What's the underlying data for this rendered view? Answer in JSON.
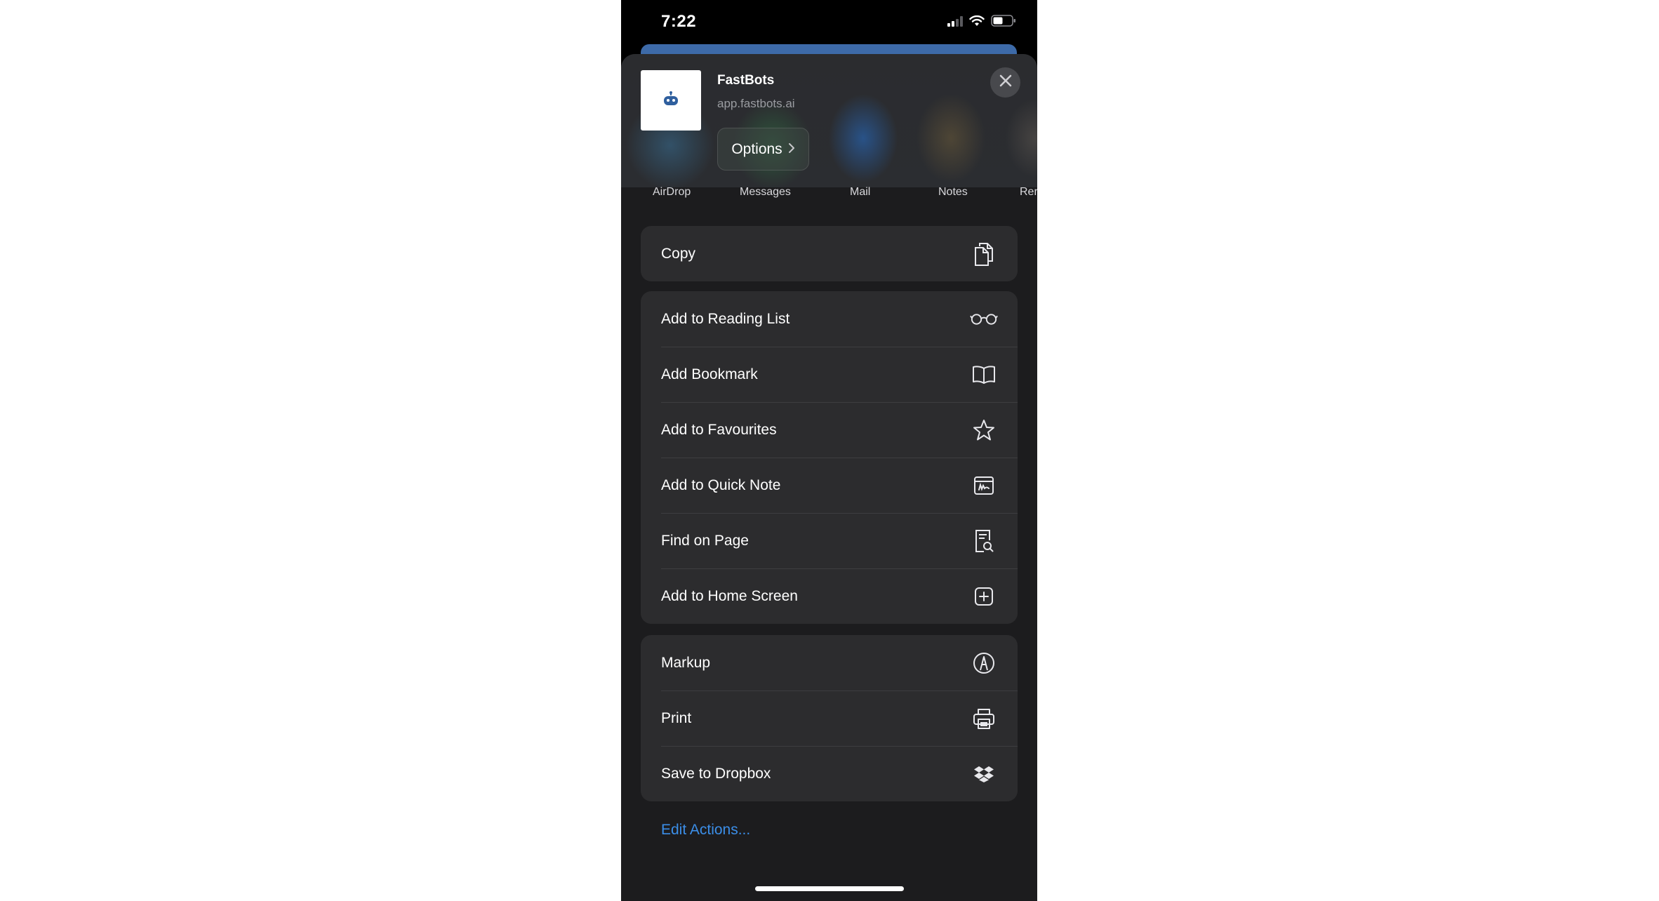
{
  "status_bar": {
    "time": "7:22"
  },
  "share_header": {
    "title": "FastBots",
    "url": "app.fastbots.ai",
    "options_label": "Options"
  },
  "share_targets": [
    {
      "label": "AirDrop"
    },
    {
      "label": "Messages"
    },
    {
      "label": "Mail"
    },
    {
      "label": "Notes"
    },
    {
      "label": "Rer"
    }
  ],
  "groups": [
    {
      "items": [
        {
          "label": "Copy",
          "icon": "copy-icon"
        }
      ]
    },
    {
      "items": [
        {
          "label": "Add to Reading List",
          "icon": "glasses-icon"
        },
        {
          "label": "Add Bookmark",
          "icon": "book-icon"
        },
        {
          "label": "Add to Favourites",
          "icon": "star-icon"
        },
        {
          "label": "Add to Quick Note",
          "icon": "quick-note-icon"
        },
        {
          "label": "Find on Page",
          "icon": "find-page-icon"
        },
        {
          "label": "Add to Home Screen",
          "icon": "plus-square-icon"
        }
      ]
    },
    {
      "items": [
        {
          "label": "Markup",
          "icon": "markup-icon"
        },
        {
          "label": "Print",
          "icon": "printer-icon"
        },
        {
          "label": "Save to Dropbox",
          "icon": "dropbox-icon"
        }
      ]
    }
  ],
  "edit_actions_label": "Edit Actions...",
  "colors": {
    "sheet_background": "#1c1c1e",
    "row_background": "#2c2c2e",
    "link_blue": "#3b8ee8"
  }
}
